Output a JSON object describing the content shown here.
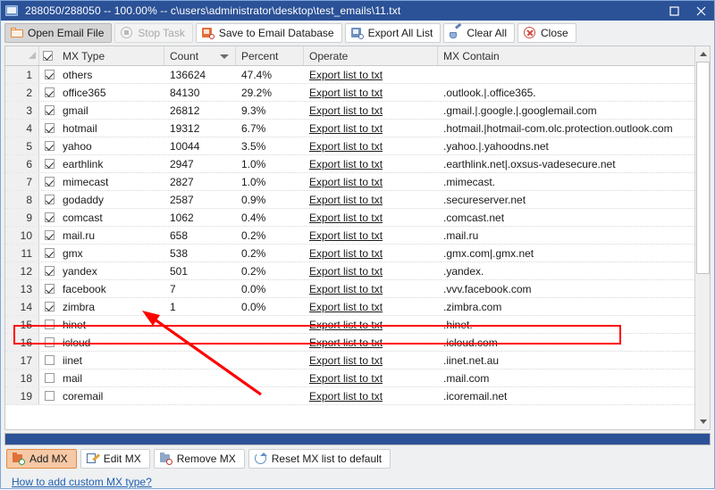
{
  "window": {
    "title": "288050/288050 -- 100.00% -- c\\users\\administrator\\desktop\\test_emails\\11.txt",
    "app_icon": "app-window-icon",
    "controls": {
      "maximize": "maximize-icon",
      "close": "close-icon"
    }
  },
  "toolbar": {
    "buttons": [
      {
        "label": "Open Email File",
        "icon": "folder-icon",
        "state": "active"
      },
      {
        "label": "Stop Task",
        "icon": "stop-icon",
        "state": "disabled"
      },
      {
        "label": "Save to Email Database",
        "icon": "database-save-icon",
        "state": "normal"
      },
      {
        "label": "Export All List",
        "icon": "export-icon",
        "state": "normal"
      },
      {
        "label": "Clear All",
        "icon": "brush-icon",
        "state": "normal"
      },
      {
        "label": "Close",
        "icon": "close-circle-icon",
        "state": "normal"
      }
    ]
  },
  "grid": {
    "select_all_checked": true,
    "sort_column": "Count",
    "sort_direction": "desc",
    "columns": [
      {
        "key": "rownum",
        "label": ""
      },
      {
        "key": "checkbox",
        "label": ""
      },
      {
        "key": "mxtype",
        "label": "MX Type"
      },
      {
        "key": "count",
        "label": "Count"
      },
      {
        "key": "percent",
        "label": "Percent"
      },
      {
        "key": "operate",
        "label": "Operate"
      },
      {
        "key": "contain",
        "label": "MX Contain"
      }
    ],
    "operate_link_label": "Export list to txt",
    "rows": [
      {
        "num": "1",
        "checked": true,
        "mxtype": "others",
        "count": "136624",
        "percent": "47.4%",
        "contain": ""
      },
      {
        "num": "2",
        "checked": true,
        "mxtype": "office365",
        "count": "84130",
        "percent": "29.2%",
        "contain": ".outlook.|.office365."
      },
      {
        "num": "3",
        "checked": true,
        "mxtype": "gmail",
        "count": "26812",
        "percent": "9.3%",
        "contain": ".gmail.|.google.|.googlemail.com"
      },
      {
        "num": "4",
        "checked": true,
        "mxtype": "hotmail",
        "count": "19312",
        "percent": "6.7%",
        "contain": ".hotmail.|hotmail-com.olc.protection.outlook.com"
      },
      {
        "num": "5",
        "checked": true,
        "mxtype": "yahoo",
        "count": "10044",
        "percent": "3.5%",
        "contain": ".yahoo.|.yahoodns.net"
      },
      {
        "num": "6",
        "checked": true,
        "mxtype": "earthlink",
        "count": "2947",
        "percent": "1.0%",
        "contain": ".earthlink.net|.oxsus-vadesecure.net"
      },
      {
        "num": "7",
        "checked": true,
        "mxtype": "mimecast",
        "count": "2827",
        "percent": "1.0%",
        "contain": ".mimecast."
      },
      {
        "num": "8",
        "checked": true,
        "mxtype": "godaddy",
        "count": "2587",
        "percent": "0.9%",
        "contain": ".secureserver.net"
      },
      {
        "num": "9",
        "checked": true,
        "mxtype": "comcast",
        "count": "1062",
        "percent": "0.4%",
        "contain": ".comcast.net"
      },
      {
        "num": "10",
        "checked": true,
        "mxtype": "mail.ru",
        "count": "658",
        "percent": "0.2%",
        "contain": ".mail.ru"
      },
      {
        "num": "11",
        "checked": true,
        "mxtype": "gmx",
        "count": "538",
        "percent": "0.2%",
        "contain": ".gmx.com|.gmx.net"
      },
      {
        "num": "12",
        "checked": true,
        "mxtype": "yandex",
        "count": "501",
        "percent": "0.2%",
        "contain": ".yandex."
      },
      {
        "num": "13",
        "checked": true,
        "mxtype": "facebook",
        "count": "7",
        "percent": "0.0%",
        "contain": ".vvv.facebook.com"
      },
      {
        "num": "14",
        "checked": true,
        "mxtype": "zimbra",
        "count": "1",
        "percent": "0.0%",
        "contain": ".zimbra.com"
      },
      {
        "num": "15",
        "checked": false,
        "mxtype": "hinet",
        "count": "",
        "percent": "",
        "contain": ".hinet."
      },
      {
        "num": "16",
        "checked": false,
        "mxtype": "icloud",
        "count": "",
        "percent": "",
        "contain": ".icloud.com"
      },
      {
        "num": "17",
        "checked": false,
        "mxtype": "iinet",
        "count": "",
        "percent": "",
        "contain": ".iinet.net.au"
      },
      {
        "num": "18",
        "checked": false,
        "mxtype": "mail",
        "count": "",
        "percent": "",
        "contain": ".mail.com"
      },
      {
        "num": "19",
        "checked": false,
        "mxtype": "coremail",
        "count": "",
        "percent": "",
        "contain": ".icoremail.net"
      }
    ]
  },
  "scrollbar": {
    "up_icon": "scroll-up-arrow-icon",
    "down_icon": "scroll-down-arrow-icon"
  },
  "bottombar": {
    "buttons": [
      {
        "label": "Add MX",
        "icon": "add-mx-icon",
        "state": "highlight"
      },
      {
        "label": "Edit MX",
        "icon": "edit-mx-icon",
        "state": "normal"
      },
      {
        "label": "Remove MX",
        "icon": "remove-mx-icon",
        "state": "normal"
      },
      {
        "label": "Reset MX list to default",
        "icon": "reset-icon",
        "state": "normal"
      }
    ],
    "help_link": "How to add custom MX type?"
  },
  "annotations": {
    "highlight_color": "#ff0000",
    "highlighted_row": "13",
    "arrow_color": "#ff0000"
  },
  "colors": {
    "titlebar": "#2b5197",
    "accent_orange": "#e08a42",
    "link_blue": "#1f5fae"
  }
}
